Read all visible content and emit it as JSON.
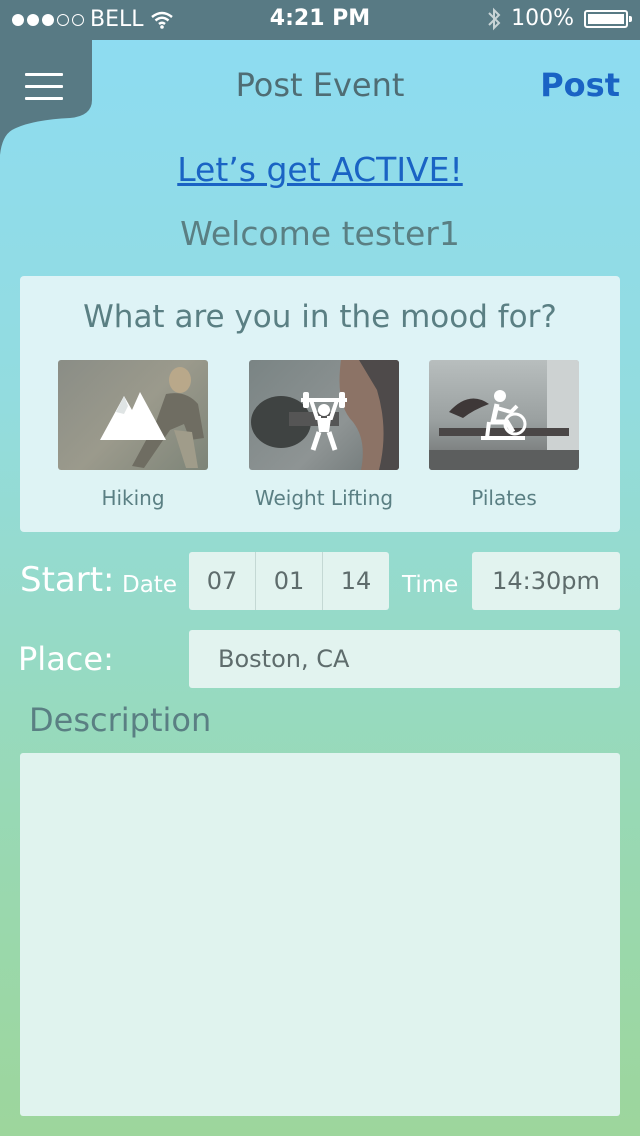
{
  "status_bar": {
    "carrier": "BELL",
    "time": "4:21 PM",
    "battery": "100%",
    "signal_filled": 3,
    "signal_total": 5,
    "battery_level": 1.0
  },
  "nav": {
    "title": "Post Event",
    "post_label": "Post",
    "menu_icon": "hamburger-icon"
  },
  "cta": "Let’s get ACTIVE!",
  "welcome": "Welcome tester1",
  "mood": {
    "title": "What are you in the mood for?",
    "activities": [
      {
        "label": "Hiking",
        "icon": "mountain-icon"
      },
      {
        "label": "Weight Lifting",
        "icon": "weightlifter-icon"
      },
      {
        "label": "Pilates",
        "icon": "exercise-bike-icon"
      }
    ]
  },
  "start": {
    "label": "Start:",
    "date_label": "Date",
    "month": "07",
    "day": "01",
    "year": "14",
    "time_label": "Time",
    "time_value": "14:30pm"
  },
  "place": {
    "label": "Place:",
    "value": "Boston, CA"
  },
  "description": {
    "label": "Description",
    "value": ""
  },
  "colors": {
    "status_bar": "#587a84",
    "accent": "#1a63c4",
    "muted_text": "#5a7f83"
  }
}
